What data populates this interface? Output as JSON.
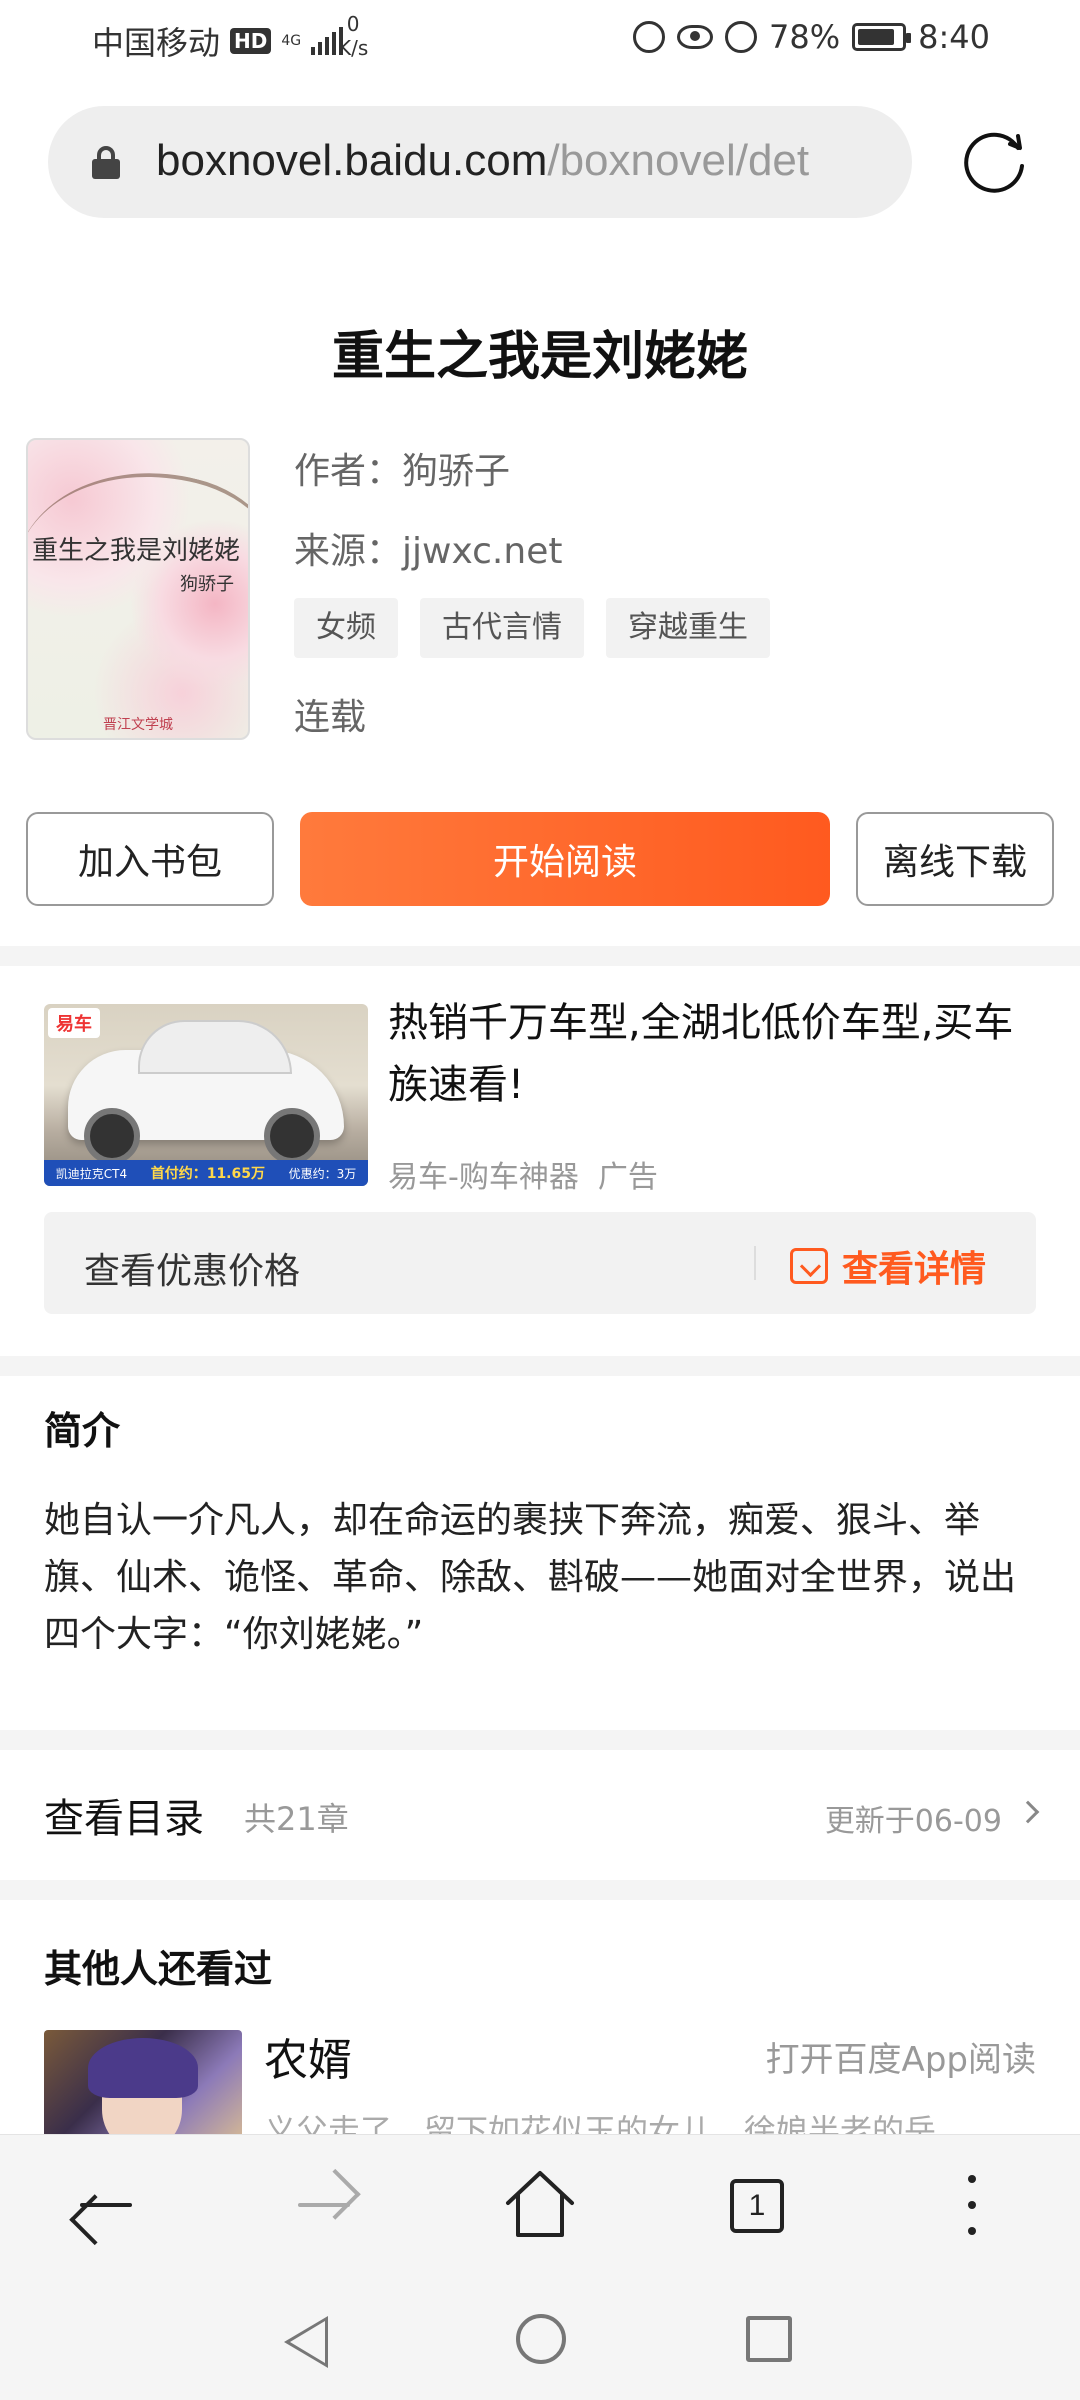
{
  "status_bar": {
    "carrier": "中国移动",
    "hd_badge": "HD",
    "network_type": "4G",
    "speed_value": "0",
    "speed_unit": "K/s",
    "battery_percent": "78%",
    "time": "8:40"
  },
  "address_bar": {
    "host": "boxnovel.baidu.com",
    "path": "/boxnovel/det"
  },
  "book": {
    "title": "重生之我是刘姥姥",
    "author_label": "作者：",
    "author": "狗骄子",
    "source_label": "来源：",
    "source": "jjwxc.net",
    "tags": [
      "女频",
      "古代言情",
      "穿越重生"
    ],
    "status": "连载",
    "cover": {
      "title": "重生之我是刘姥姥",
      "author": "狗骄子",
      "publisher": "晋江文学城"
    }
  },
  "actions": {
    "add_shelf": "加入书包",
    "start_read": "开始阅读",
    "offline_download": "离线下载"
  },
  "ad": {
    "logo": "易车",
    "strip": [
      "凯迪拉克CT4",
      "首付约：11.65万",
      "优惠约：3万"
    ],
    "headline": "热销千万车型,全湖北低价车型,买车族速看!",
    "source": "易车-购车神器",
    "ad_label": "广告",
    "bar_label": "查看优惠价格",
    "detail_label": "查看详情"
  },
  "synopsis": {
    "heading": "简介",
    "text": "她自认一介凡人，却在命运的裹挟下奔流，痴爱、狠斗、举旗、仙术、诡怪、革命、除敌、斟破——她面对全世界，说出四个大字：“你刘姥姥。”"
  },
  "toc": {
    "label": "查看目录",
    "count": "共21章",
    "updated": "更新于06-09"
  },
  "recommend": {
    "heading": "其他人还看过",
    "items": [
      {
        "title": "农婿",
        "action": "打开百度App阅读",
        "desc": "义父走了，留下如花似玉的女儿，徐娘半老的岳"
      }
    ]
  },
  "toolbar": {
    "tab_count": "1"
  },
  "colors": {
    "accent": "#ff5a1f",
    "accent_light": "#ff7a3c"
  }
}
